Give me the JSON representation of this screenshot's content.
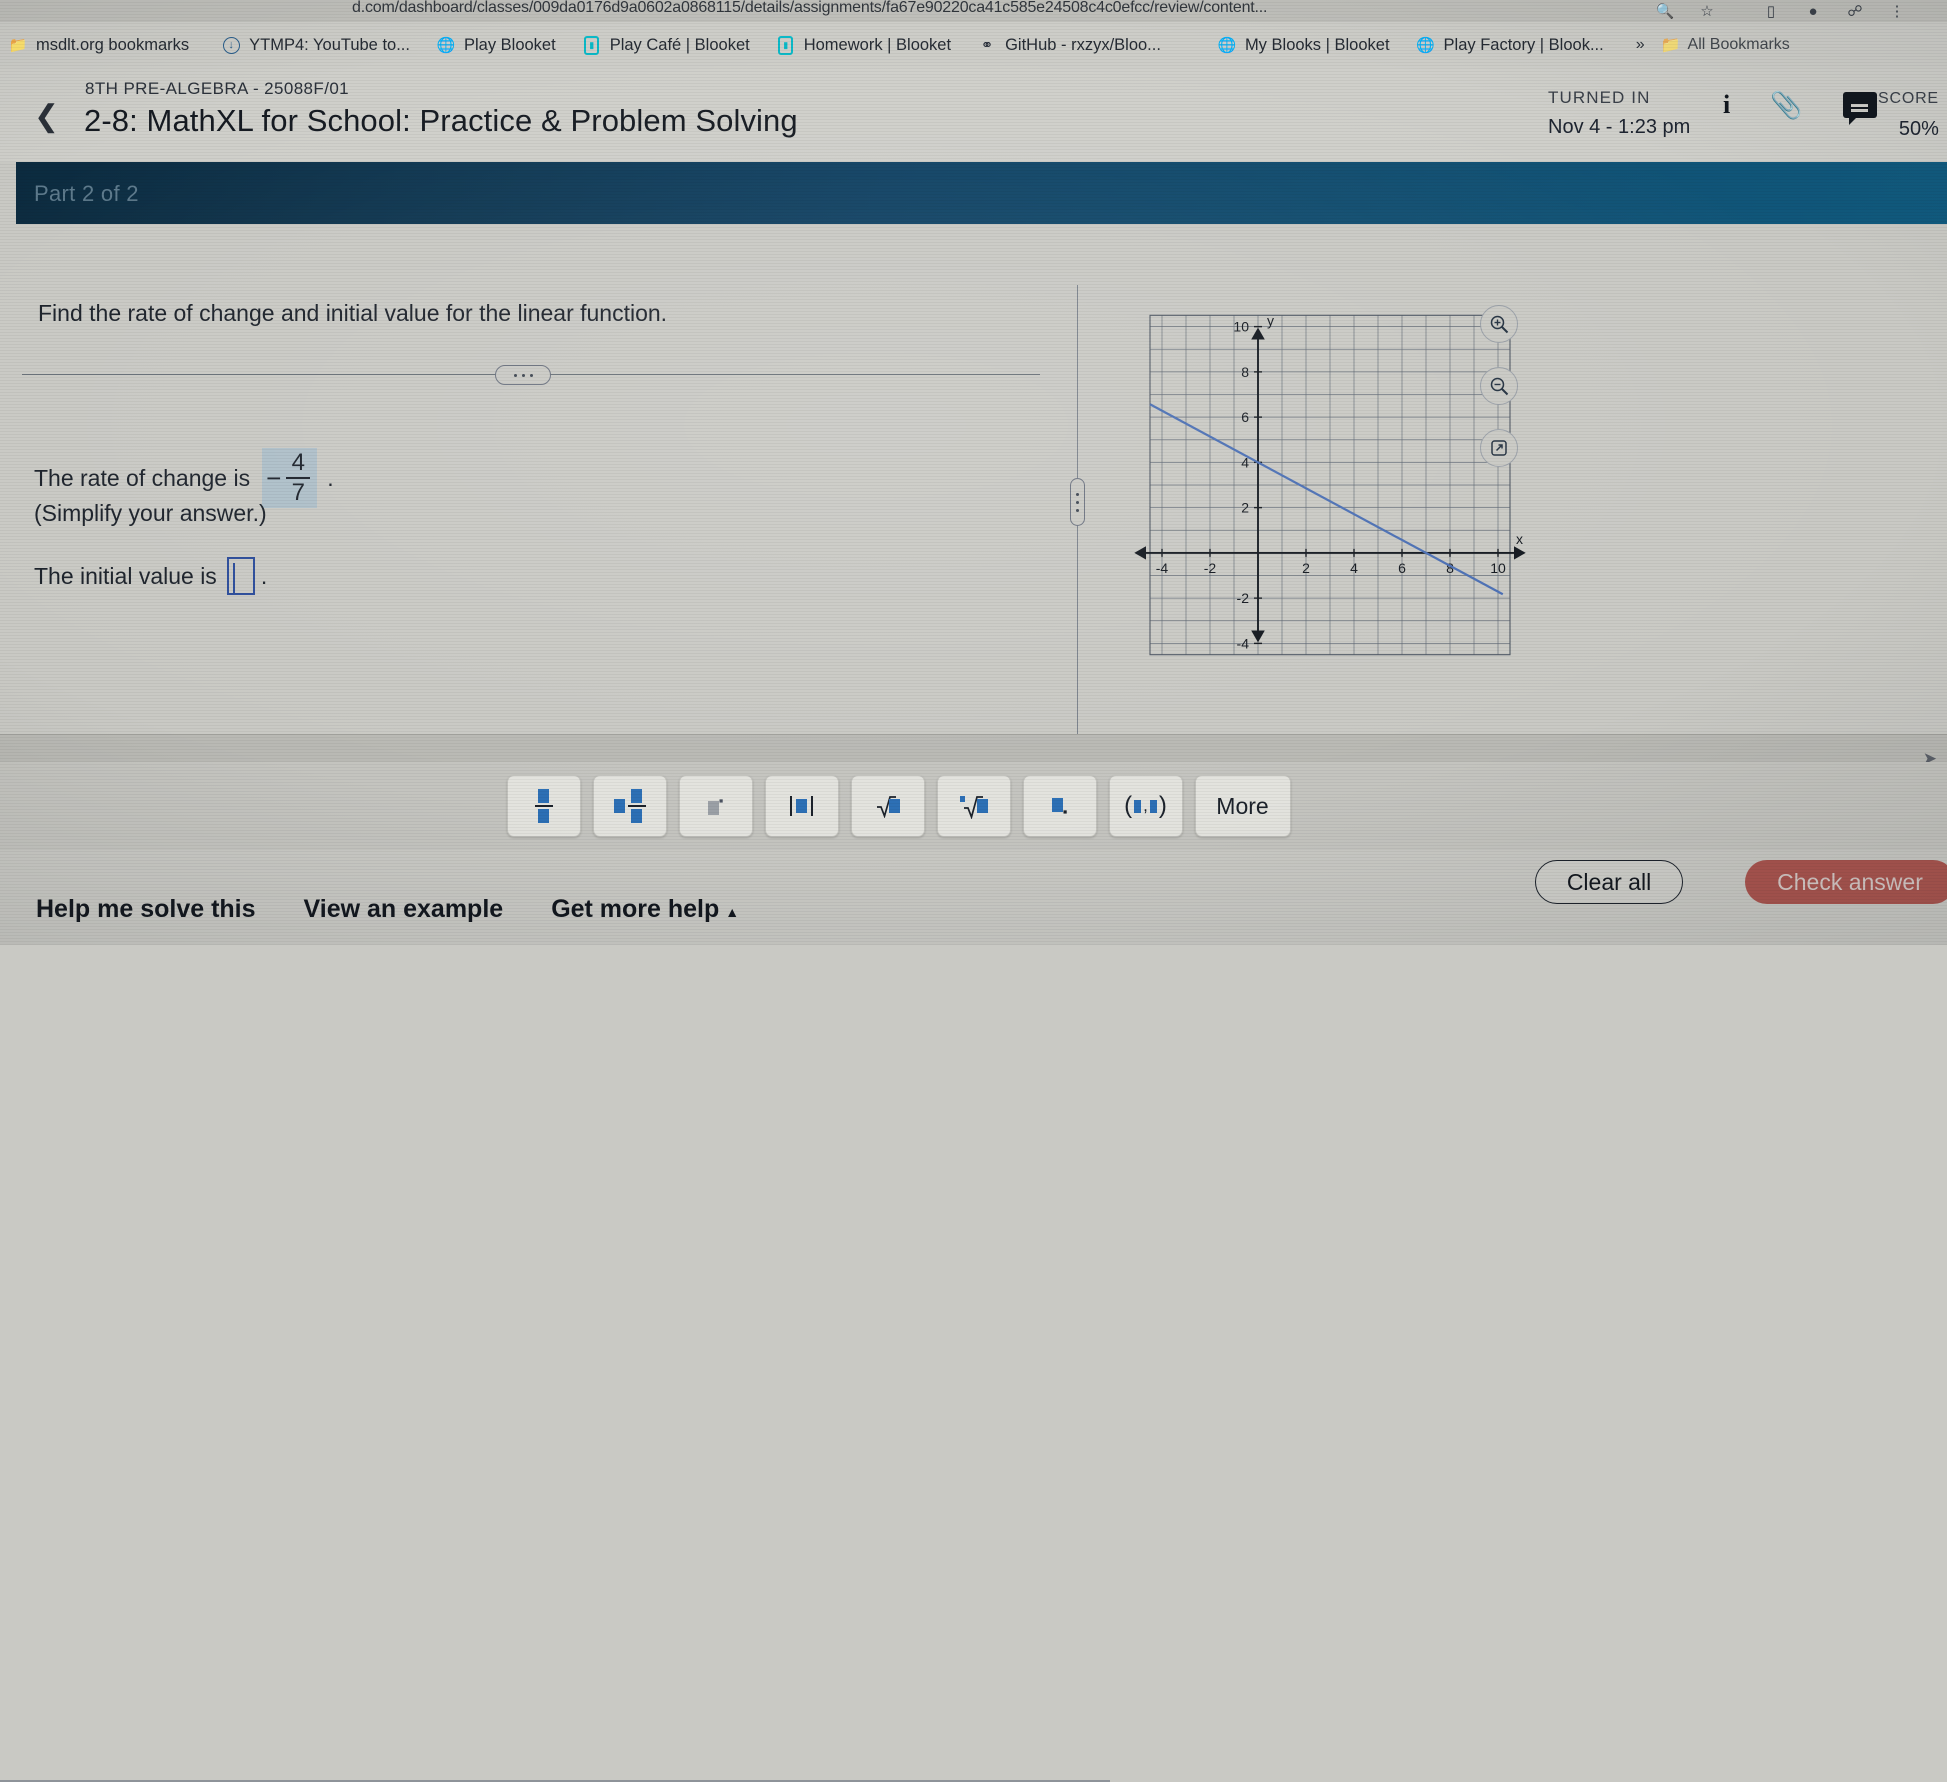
{
  "browser": {
    "url": "d.com/dashboard/classes/009da0176d9a0602a0868115/details/assignments/fa67e90220ca41c585e24508c4c0efcc/review/content...",
    "url_icons": [
      "search-icon",
      "star-icon",
      "cast-icon",
      "profile-icon",
      "extensions-icon",
      "menu-icon"
    ],
    "bookmarks": [
      {
        "label": "msdlt.org bookmarks",
        "icon": "folder-icon"
      },
      {
        "label": "YTMP4: YouTube to...",
        "icon": "download-circle-icon"
      },
      {
        "label": "Play Blooket",
        "icon": "globe-icon"
      },
      {
        "label": "Play Café | Blooket",
        "icon": "blooket-icon"
      },
      {
        "label": "Homework | Blooket",
        "icon": "blooket-icon"
      },
      {
        "label": "GitHub - rxzyx/Bloo...",
        "icon": "github-icon"
      },
      {
        "label": "My Blooks | Blooket",
        "icon": "globe-icon"
      },
      {
        "label": "Play Factory | Blook...",
        "icon": "globe-icon"
      }
    ],
    "overflow_label": "»",
    "all_bookmarks_label": "All Bookmarks"
  },
  "header": {
    "back_icon": "back-chevron-icon",
    "course_code": "8TH PRE-ALGEBRA - 25088F/01",
    "assignment_title": "2-8: MathXL for School: Practice & Problem Solving",
    "status_label": "TURNED IN",
    "status_date": "Nov 4 - 1:23 pm",
    "icons": [
      "info-icon",
      "paperclip-icon",
      "comment-icon"
    ],
    "score_label": "SCORE",
    "score_value": "50%"
  },
  "part_bar": {
    "label": "Part 2 of 2",
    "settings_icon": "gear-icon"
  },
  "question": {
    "prompt": "Find the rate of change and initial value for the linear function.",
    "divider_handle_icon": "ellipsis-handle-icon",
    "rate_label": "The rate of change is",
    "rate_sign": "−",
    "rate_numerator": "4",
    "rate_denominator": "7",
    "rate_period": ".",
    "simplify_note": "(Simplify your answer.)",
    "initial_label": "The initial value is",
    "initial_value": "",
    "initial_period": ".",
    "splitter_icon": "vertical-splitter-handle"
  },
  "graph_tools": [
    {
      "name": "zoom-in-icon",
      "glyph": "⊕"
    },
    {
      "name": "zoom-out-icon",
      "glyph": "⊖"
    },
    {
      "name": "open-external-icon",
      "glyph": "↗"
    }
  ],
  "chart_data": {
    "type": "line",
    "title": "",
    "xlabel": "x",
    "ylabel": "y",
    "xlim": [
      -5,
      11
    ],
    "ylim": [
      -5,
      11
    ],
    "x_ticks": [
      -4,
      -2,
      2,
      4,
      6,
      8,
      10
    ],
    "y_ticks": [
      -4,
      -2,
      2,
      4,
      6,
      8,
      10
    ],
    "grid": true,
    "grid_step": 1,
    "legend": "none",
    "series": [
      {
        "name": "linear function",
        "color": "#4a6fb5",
        "slope": -0.5714285714,
        "intercept": 4,
        "points": [
          [
            -4.5,
            6.57
          ],
          [
            0,
            4
          ],
          [
            7,
            0
          ],
          [
            10.2,
            -1.83
          ]
        ]
      }
    ]
  },
  "math_toolbar": {
    "buttons": [
      {
        "name": "fraction-button",
        "kind": "fraction",
        "label": ""
      },
      {
        "name": "mixed-number-button",
        "kind": "mixed",
        "label": ""
      },
      {
        "name": "exponent-button",
        "kind": "exponent",
        "label": ""
      },
      {
        "name": "absolute-value-button",
        "kind": "abs",
        "label": ""
      },
      {
        "name": "square-root-button",
        "kind": "sqrt",
        "label": ""
      },
      {
        "name": "nth-root-button",
        "kind": "nthroot",
        "label": ""
      },
      {
        "name": "subscript-button",
        "kind": "subscript",
        "label": ""
      },
      {
        "name": "ordered-pair-button",
        "kind": "pair",
        "label": ""
      },
      {
        "name": "more-button",
        "kind": "text",
        "label": "More"
      }
    ]
  },
  "footer": {
    "help_me_solve": "Help me solve this",
    "view_example": "View an example",
    "get_more_help": "Get more help",
    "get_more_help_caret": "▲",
    "clear_all": "Clear all",
    "check_answer": "Check answer"
  },
  "colors": {
    "part_bar": "#0f4163",
    "highlight": "#aebfc9",
    "line": "#4a6fb5",
    "check_button": "#a33a33",
    "page_bg": "#c9c9c4"
  }
}
